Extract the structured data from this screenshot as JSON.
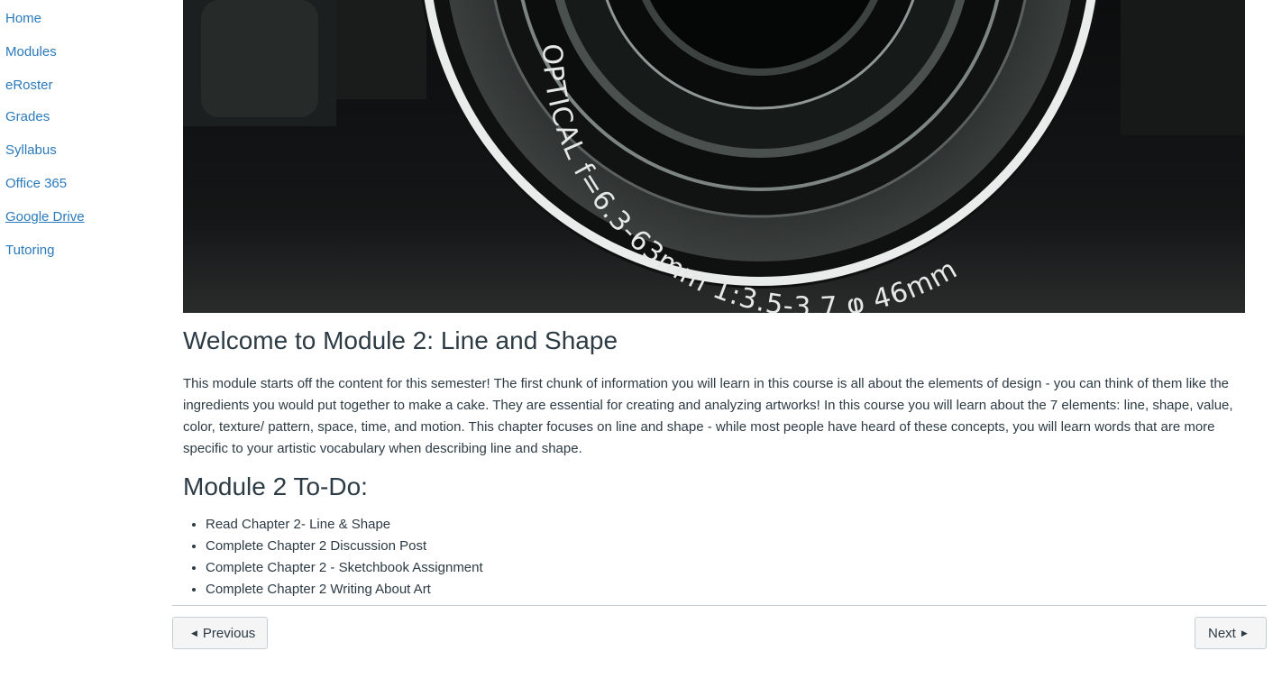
{
  "nav": {
    "items": [
      {
        "label": "Home"
      },
      {
        "label": "Modules"
      },
      {
        "label": "eRoster"
      },
      {
        "label": "Grades"
      },
      {
        "label": "Syllabus"
      },
      {
        "label": "Office 365"
      },
      {
        "label": "Google Drive"
      },
      {
        "label": "Tutoring"
      }
    ],
    "link_color": "#2b7abc"
  },
  "hero": {
    "lens_text": "OPTICAL  f=6.3-63mm  1:3.5-3.7  φ 46mm"
  },
  "page": {
    "title": "Welcome to Module 2: Line and Shape",
    "intro": "This module starts off the content for this semester! The first chunk of information you will learn in this course is all about the elements of design - you can think of them like the ingredients you would put together to make a cake. They are essential for creating and analyzing artworks! In this course you will learn about the 7 elements: line, shape, value, color, texture/ pattern, space, time, and motion. This chapter focuses on line and shape - while most people have heard of these concepts, you will learn words that are more specific to your artistic vocabulary when describing line and shape.",
    "todo_title": "Module 2 To-Do:",
    "todo_items": [
      "Read Chapter 2- Line & Shape",
      "Complete Chapter 2 Discussion Post",
      "Complete Chapter 2 - Sketchbook Assignment",
      "Complete Chapter 2 Writing About Art"
    ]
  },
  "footer": {
    "previous_label": "Previous",
    "next_label": "Next"
  },
  "colors": {
    "text": "#2d3b45",
    "link": "#2b7abc",
    "border": "#c7cdd1",
    "button_bg": "#f5f5f5"
  }
}
